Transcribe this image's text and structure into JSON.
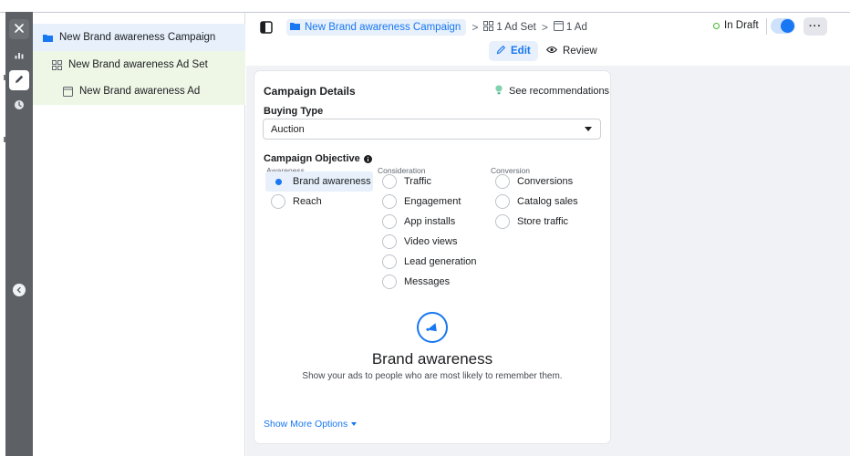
{
  "colors": {
    "accent": "#1877f2",
    "selected_bg": "#e7f0fb",
    "child_rows_bg": "#eef7e6",
    "rail_bg": "#5d6166",
    "main_bg": "#f0f2f5",
    "draft_status": "#42b72a"
  },
  "rail": {
    "items": [
      {
        "icon": "close-icon"
      },
      {
        "icon": "bar-chart-icon"
      },
      {
        "icon": "pencil-icon"
      },
      {
        "icon": "clock-icon"
      }
    ],
    "collapse_icon": "chevron-left-icon"
  },
  "tree": {
    "campaign": {
      "label": "New Brand awareness Campaign",
      "icon": "folder-icon"
    },
    "adset": {
      "label": "New Brand awareness Ad Set",
      "icon": "grid-icon"
    },
    "ad": {
      "label": "New Brand awareness Ad",
      "icon": "ad-icon"
    }
  },
  "header": {
    "breadcrumb": {
      "campaign": "New Brand awareness Campaign",
      "separator": ">",
      "adset": "1 Ad Set",
      "ad": "1 Ad"
    },
    "status": "In Draft",
    "toggle_on": true,
    "more_label": "···",
    "tabs": {
      "edit": "Edit",
      "review": "Review"
    }
  },
  "card": {
    "title": "Campaign Details",
    "recommendations": "See recommendations",
    "buying_type_label": "Buying Type",
    "buying_type_value": "Auction",
    "objective_label": "Campaign Objective",
    "columns": [
      {
        "heading": "Awareness",
        "options": [
          {
            "label": "Brand awareness",
            "selected": true
          },
          {
            "label": "Reach",
            "selected": false
          }
        ]
      },
      {
        "heading": "Consideration",
        "options": [
          {
            "label": "Traffic",
            "selected": false
          },
          {
            "label": "Engagement",
            "selected": false
          },
          {
            "label": "App installs",
            "selected": false
          },
          {
            "label": "Video views",
            "selected": false
          },
          {
            "label": "Lead generation",
            "selected": false
          },
          {
            "label": "Messages",
            "selected": false
          }
        ]
      },
      {
        "heading": "Conversion",
        "options": [
          {
            "label": "Conversions",
            "selected": false
          },
          {
            "label": "Catalog sales",
            "selected": false
          },
          {
            "label": "Store traffic",
            "selected": false
          }
        ]
      }
    ],
    "objective_summary": {
      "icon": "megaphone-icon",
      "title": "Brand awareness",
      "description": "Show your ads to people who are most likely to remember them."
    },
    "show_more": "Show More Options"
  }
}
